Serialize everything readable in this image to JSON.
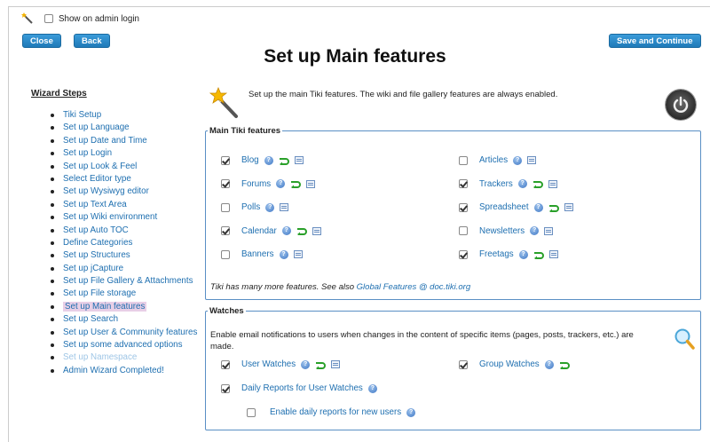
{
  "top": {
    "show_on_admin_login": "Show on admin login",
    "close_label": "Close",
    "back_label": "Back",
    "save_continue_label": "Save and Continue"
  },
  "page_title": "Set up Main features",
  "intro": "Set up the main Tiki features. The wiki and file gallery features are always enabled.",
  "steps": {
    "title": "Wizard Steps",
    "items": [
      {
        "label": "Tiki Setup",
        "state": "done"
      },
      {
        "label": "Set up Language",
        "state": "normal"
      },
      {
        "label": "Set up Date and Time",
        "state": "normal"
      },
      {
        "label": "Set up Login",
        "state": "normal"
      },
      {
        "label": "Set up Look & Feel",
        "state": "normal"
      },
      {
        "label": "Select Editor type",
        "state": "normal"
      },
      {
        "label": "Set up Wysiwyg editor",
        "state": "normal"
      },
      {
        "label": "Set up Text Area",
        "state": "normal"
      },
      {
        "label": "Set up Wiki environment",
        "state": "normal"
      },
      {
        "label": "Set up Auto TOC",
        "state": "normal"
      },
      {
        "label": "Define Categories",
        "state": "normal"
      },
      {
        "label": "Set up Structures",
        "state": "normal"
      },
      {
        "label": "Set up jCapture",
        "state": "normal"
      },
      {
        "label": "Set up File Gallery & Attachments",
        "state": "normal"
      },
      {
        "label": "Set up File storage",
        "state": "normal"
      },
      {
        "label": "Set up Main features",
        "state": "current"
      },
      {
        "label": "Set up Search",
        "state": "normal"
      },
      {
        "label": "Set up User & Community features",
        "state": "normal"
      },
      {
        "label": "Set up some advanced options",
        "state": "normal"
      },
      {
        "label": "Set up Namespace",
        "state": "disabled"
      },
      {
        "label": "Admin Wizard Completed!",
        "state": "normal"
      }
    ]
  },
  "main_features": {
    "legend": "Main Tiki features",
    "left": [
      {
        "label": "Blog",
        "checked": true,
        "arrow": true
      },
      {
        "label": "Forums",
        "checked": true,
        "arrow": true
      },
      {
        "label": "Polls",
        "checked": false,
        "arrow": false
      },
      {
        "label": "Calendar",
        "checked": true,
        "arrow": true
      },
      {
        "label": "Banners",
        "checked": false,
        "arrow": false
      }
    ],
    "right": [
      {
        "label": "Articles",
        "checked": false,
        "arrow": false
      },
      {
        "label": "Trackers",
        "checked": true,
        "arrow": true
      },
      {
        "label": "Spreadsheet",
        "checked": true,
        "arrow": true
      },
      {
        "label": "Newsletters",
        "checked": false,
        "arrow": false
      },
      {
        "label": "Freetags",
        "checked": true,
        "arrow": true
      }
    ],
    "note_prefix": "Tiki has many more features. See also ",
    "note_link": "Global Features @ doc.tiki.org"
  },
  "watches": {
    "legend": "Watches",
    "description": "Enable email notifications to users when changes in the content of specific items (pages, posts, trackers, etc.) are made.",
    "user_watches": "User Watches",
    "group_watches": "Group Watches",
    "daily_reports": "Daily Reports for User Watches",
    "daily_new_users": "Enable daily reports for new users"
  },
  "colors": {
    "accent": "#1e6fb0",
    "button": "#2387c8",
    "fieldset_border": "#5a8fc4"
  }
}
